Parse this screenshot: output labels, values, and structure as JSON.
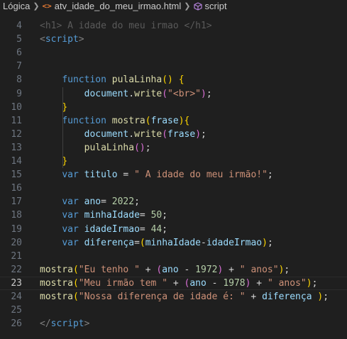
{
  "breadcrumb": {
    "folder": "Lógica",
    "file_icon": "<>",
    "file": "atv_idade_do_meu_irmao.html",
    "symbol": "script"
  },
  "editor": {
    "partial_top_line": "<h1> A idade do meu irmao </h1>",
    "current_line": 23,
    "lines": [
      {
        "n": "4",
        "tokens": []
      },
      {
        "n": "5",
        "tokens": [
          [
            "tag",
            "<"
          ],
          [
            "tagname",
            "script"
          ],
          [
            "tag",
            ">"
          ]
        ]
      },
      {
        "n": "6",
        "tokens": []
      },
      {
        "n": "7",
        "tokens": []
      },
      {
        "n": "8",
        "tokens": [
          [
            "sp",
            "    "
          ],
          [
            "kw",
            "function"
          ],
          [
            "sp",
            " "
          ],
          [
            "fn",
            "pulaLinha"
          ],
          [
            "b1",
            "()"
          ],
          [
            "sp",
            " "
          ],
          [
            "b1",
            "{"
          ]
        ]
      },
      {
        "n": "9",
        "tokens": [
          [
            "sp",
            "        "
          ],
          [
            "var",
            "document"
          ],
          [
            "punc",
            "."
          ],
          [
            "fn",
            "write"
          ],
          [
            "b2",
            "("
          ],
          [
            "str",
            "\"<br>\""
          ],
          [
            "b2",
            ")"
          ],
          [
            "punc",
            ";"
          ]
        ]
      },
      {
        "n": "10",
        "tokens": [
          [
            "sp",
            "    "
          ],
          [
            "b1",
            "}"
          ]
        ]
      },
      {
        "n": "11",
        "tokens": [
          [
            "sp",
            "    "
          ],
          [
            "kw",
            "function"
          ],
          [
            "sp",
            " "
          ],
          [
            "fn",
            "mostra"
          ],
          [
            "b1",
            "("
          ],
          [
            "var",
            "frase"
          ],
          [
            "b1",
            ")"
          ],
          [
            "b1",
            "{"
          ]
        ]
      },
      {
        "n": "12",
        "tokens": [
          [
            "sp",
            "        "
          ],
          [
            "var",
            "document"
          ],
          [
            "punc",
            "."
          ],
          [
            "fn",
            "write"
          ],
          [
            "b2",
            "("
          ],
          [
            "var",
            "frase"
          ],
          [
            "b2",
            ")"
          ],
          [
            "punc",
            ";"
          ]
        ]
      },
      {
        "n": "13",
        "tokens": [
          [
            "sp",
            "        "
          ],
          [
            "fn",
            "pulaLinha"
          ],
          [
            "b2",
            "()"
          ],
          [
            "punc",
            ";"
          ]
        ]
      },
      {
        "n": "14",
        "tokens": [
          [
            "sp",
            "    "
          ],
          [
            "b1",
            "}"
          ]
        ]
      },
      {
        "n": "15",
        "tokens": [
          [
            "sp",
            "    "
          ],
          [
            "kw",
            "var"
          ],
          [
            "sp",
            " "
          ],
          [
            "var",
            "titulo"
          ],
          [
            "punc",
            " = "
          ],
          [
            "str",
            "\" A idade do meu irmão!\""
          ],
          [
            "punc",
            ";"
          ]
        ]
      },
      {
        "n": "16",
        "tokens": []
      },
      {
        "n": "17",
        "tokens": [
          [
            "sp",
            "    "
          ],
          [
            "kw",
            "var"
          ],
          [
            "sp",
            " "
          ],
          [
            "var",
            "ano"
          ],
          [
            "punc",
            "= "
          ],
          [
            "num",
            "2022"
          ],
          [
            "punc",
            ";"
          ]
        ]
      },
      {
        "n": "18",
        "tokens": [
          [
            "sp",
            "    "
          ],
          [
            "kw",
            "var"
          ],
          [
            "sp",
            " "
          ],
          [
            "var",
            "minhaIdade"
          ],
          [
            "punc",
            "= "
          ],
          [
            "num",
            "50"
          ],
          [
            "punc",
            ";"
          ]
        ]
      },
      {
        "n": "19",
        "tokens": [
          [
            "sp",
            "    "
          ],
          [
            "kw",
            "var"
          ],
          [
            "sp",
            " "
          ],
          [
            "var",
            "idadeIrmao"
          ],
          [
            "punc",
            "= "
          ],
          [
            "num",
            "44"
          ],
          [
            "punc",
            ";"
          ]
        ]
      },
      {
        "n": "20",
        "tokens": [
          [
            "sp",
            "    "
          ],
          [
            "kw",
            "var"
          ],
          [
            "sp",
            " "
          ],
          [
            "var",
            "diferença"
          ],
          [
            "punc",
            "="
          ],
          [
            "b1",
            "("
          ],
          [
            "var",
            "minhaIdade"
          ],
          [
            "punc",
            "-"
          ],
          [
            "var",
            "idadeIrmao"
          ],
          [
            "b1",
            ")"
          ],
          [
            "punc",
            ";"
          ]
        ]
      },
      {
        "n": "21",
        "tokens": []
      },
      {
        "n": "22",
        "tokens": [
          [
            "fn",
            "mostra"
          ],
          [
            "b1",
            "("
          ],
          [
            "str",
            "\"Eu tenho \""
          ],
          [
            "punc",
            " + "
          ],
          [
            "b2",
            "("
          ],
          [
            "var",
            "ano"
          ],
          [
            "punc",
            " - "
          ],
          [
            "num",
            "1972"
          ],
          [
            "b2",
            ")"
          ],
          [
            "punc",
            " + "
          ],
          [
            "str",
            "\" anos\""
          ],
          [
            "b1",
            ")"
          ],
          [
            "punc",
            ";"
          ]
        ]
      },
      {
        "n": "23",
        "tokens": [
          [
            "fn",
            "mostra"
          ],
          [
            "b1",
            "("
          ],
          [
            "str",
            "\"Meu irmão tem \""
          ],
          [
            "punc",
            " + "
          ],
          [
            "b2",
            "("
          ],
          [
            "var",
            "ano"
          ],
          [
            "punc",
            " - "
          ],
          [
            "num",
            "1978"
          ],
          [
            "b2",
            ")"
          ],
          [
            "punc",
            " + "
          ],
          [
            "str",
            "\" anos\""
          ],
          [
            "b1",
            ")"
          ],
          [
            "punc",
            ";"
          ]
        ]
      },
      {
        "n": "24",
        "tokens": [
          [
            "fn",
            "mostra"
          ],
          [
            "b1",
            "("
          ],
          [
            "str",
            "\"Nossa diferença de idade é: \""
          ],
          [
            "punc",
            " + "
          ],
          [
            "var",
            "diferença"
          ],
          [
            "punc",
            " "
          ],
          [
            "b1",
            ")"
          ],
          [
            "punc",
            ";"
          ]
        ]
      },
      {
        "n": "25",
        "tokens": []
      },
      {
        "n": "26",
        "tokens": [
          [
            "tag",
            "</"
          ],
          [
            "tagname",
            "script"
          ],
          [
            "tag",
            ">"
          ]
        ]
      }
    ]
  },
  "colors": {
    "background": "#1f1f1f",
    "keyword": "#569cd6",
    "function": "#dcdcaa",
    "variable": "#9cdcfe",
    "string": "#ce9178",
    "number": "#b5cea8"
  }
}
